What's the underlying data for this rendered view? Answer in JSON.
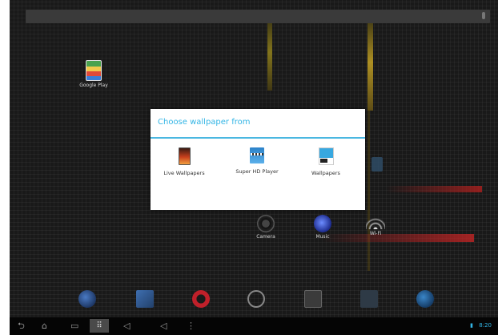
{
  "search": {
    "hint": ""
  },
  "desktop": {
    "shortcuts": [
      {
        "label": "Google Play"
      },
      {
        "label": "Camera"
      },
      {
        "label": "Music"
      },
      {
        "label": "Wi-Fi"
      }
    ]
  },
  "dialog": {
    "title": "Choose wallpaper from",
    "options": [
      {
        "label": "Live Wallpapers",
        "icon": "live-wallpapers-icon"
      },
      {
        "label": "Super HD Player",
        "icon": "super-hd-player-icon"
      },
      {
        "label": "Wallpapers",
        "icon": "wallpapers-icon"
      }
    ]
  },
  "nav": {
    "back": "⮌",
    "home": "⌂",
    "recents": "▭",
    "menu": "⠿",
    "vol_down": "◁",
    "vol_up": "◁",
    "screenshot": "⋮"
  },
  "status": {
    "battery": "▮",
    "time": "8:20"
  },
  "colors": {
    "accent": "#33b5e5",
    "background": "#191919"
  }
}
